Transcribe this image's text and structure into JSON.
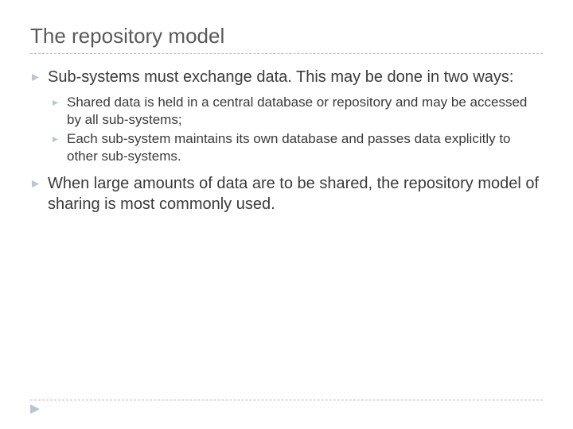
{
  "title": "The repository model",
  "bullets": [
    {
      "text": "Sub-systems must exchange data. This may be done in two ways:",
      "children": [
        {
          "text": "Shared data is held in a central database or repository and may be accessed by all sub-systems;"
        },
        {
          "text": "Each sub-system maintains its own database and passes data explicitly to other sub-systems."
        }
      ]
    },
    {
      "text": "When large amounts of data are to be shared, the repository model of sharing is most commonly used.",
      "children": []
    }
  ],
  "colors": {
    "bullet_icon": "#b9c6cf",
    "text": "#3a3a3a",
    "title": "#595959",
    "rule": "#b8b8b8"
  }
}
